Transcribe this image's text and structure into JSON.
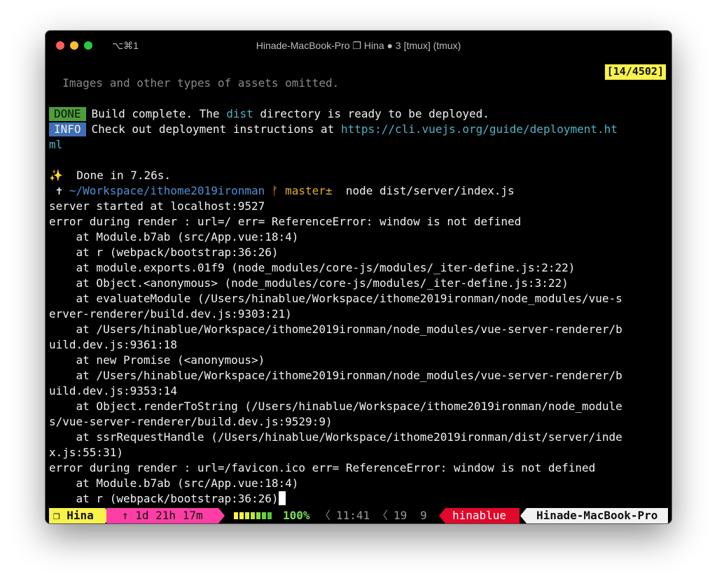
{
  "window": {
    "shortcut": "⌥⌘1",
    "title": "Hinade-MacBook-Pro ❐ Hina ● 3 [tmux] (tmux)"
  },
  "terminal": {
    "position": "[14/4502]",
    "omitted": "  Images and other types of assets omitted.",
    "done_badge": "DONE",
    "done_text_1": "Build complete. The ",
    "done_dist": "dist",
    "done_text_2": " directory is ready to be deployed.",
    "info_badge": "INFO",
    "info_text": "Check out deployment instructions at ",
    "info_url_1": "https://cli.vuejs.org/guide/deployment.ht",
    "info_url_2": "ml",
    "done_time": "✨  Done in 7.26s.",
    "prompt_cross": " ✝ ",
    "prompt_path": "~/Workspace/ithome2019ironman",
    "prompt_branch": " ᚠ master±",
    "prompt_cmd": "  node dist/server/index.js",
    "output": [
      "server started at localhost:9527",
      "error during render : url=/ err= ReferenceError: window is not defined",
      "    at Module.b7ab (src/App.vue:18:4)",
      "    at r (webpack/bootstrap:36:26)",
      "    at module.exports.01f9 (node_modules/core-js/modules/_iter-define.js:2:22)",
      "    at Object.<anonymous> (node_modules/core-js/modules/_iter-define.js:3:22)",
      "    at evaluateModule (/Users/hinablue/Workspace/ithome2019ironman/node_modules/vue-s",
      "erver-renderer/build.dev.js:9303:21)",
      "    at /Users/hinablue/Workspace/ithome2019ironman/node_modules/vue-server-renderer/b",
      "uild.dev.js:9361:18",
      "    at new Promise (<anonymous>)",
      "    at /Users/hinablue/Workspace/ithome2019ironman/node_modules/vue-server-renderer/b",
      "uild.dev.js:9353:14",
      "    at Object.renderToString (/Users/hinablue/Workspace/ithome2019ironman/node_module",
      "s/vue-server-renderer/build.dev.js:9529:9)",
      "    at ssrRequestHandle (/Users/hinablue/Workspace/ithome2019ironman/dist/server/inde",
      "x.js:55:31)",
      "error during render : url=/favicon.ico err= ReferenceError: window is not defined",
      "    at Module.b7ab (src/App.vue:18:4)",
      "    at r (webpack/bootstrap:36:26)"
    ]
  },
  "statusbar": {
    "session": "❐ Hina",
    "uptime": "↑ 1d 21h 17m",
    "battery_percent": "100%",
    "time": "11:41",
    "date_day": "19",
    "date_month": "9",
    "user": "hinablue",
    "host": "Hinade-MacBook-Pro",
    "battery_level": 1.0
  },
  "colors": {
    "session_bg": "#f9f24b",
    "uptime_bg": "#ff3ea5",
    "user_bg": "#e0092b",
    "host_bg": "#f2f2f2",
    "done_badge": "#4c9f3b",
    "info_badge": "#3f6fb6"
  }
}
